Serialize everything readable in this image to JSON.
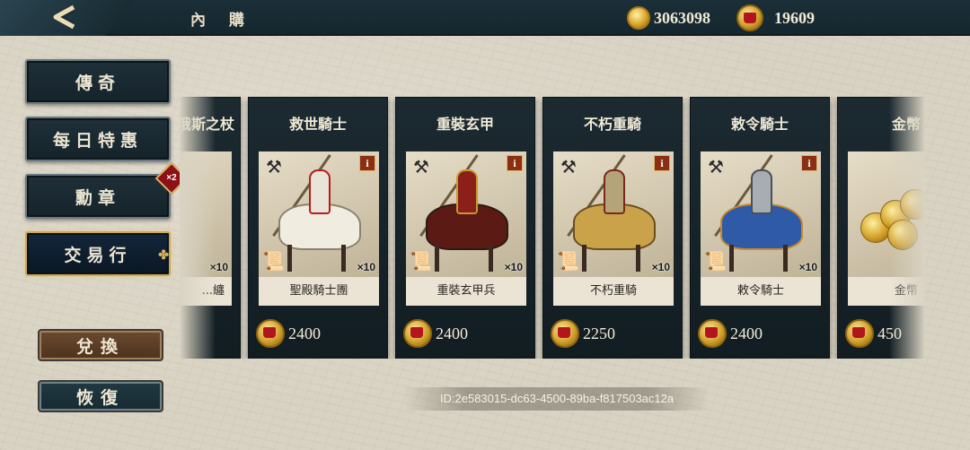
{
  "header": {
    "title": "內 購",
    "gold_amount": "3063098",
    "crown_amount": "19609"
  },
  "side_menu": {
    "items": [
      {
        "label": "傳奇",
        "active": false
      },
      {
        "label": "每日特惠",
        "active": false
      },
      {
        "label": "勳章",
        "active": false,
        "badge": "×2"
      },
      {
        "label": "交易行",
        "active": true
      }
    ],
    "exchange_label": "兌換",
    "restore_label": "恢復"
  },
  "cards": [
    {
      "name": "俄斯之杖",
      "subname": "...纏",
      "qty": "×10",
      "price": ""
    },
    {
      "name": "救世騎士",
      "subname": "聖殿騎士團",
      "qty": "×10",
      "price": "2400"
    },
    {
      "name": "重裝玄甲",
      "subname": "重裝玄甲兵",
      "qty": "×10",
      "price": "2400"
    },
    {
      "name": "不朽重騎",
      "subname": "不朽重騎",
      "qty": "×10",
      "price": "2250"
    },
    {
      "name": "敕令騎士",
      "subname": "敕令騎士",
      "qty": "×10",
      "price": "2400"
    },
    {
      "name": "金幣",
      "subname": "金幣",
      "qty": "",
      "price": "450"
    }
  ],
  "footer": {
    "device_id": "ID:2e583015-dc63-4500-89ba-f817503ac12a"
  },
  "colors": {
    "panel_dark": "#1c2a31",
    "accent_gold": "#d6b15f",
    "background": "#d9d3c3"
  }
}
